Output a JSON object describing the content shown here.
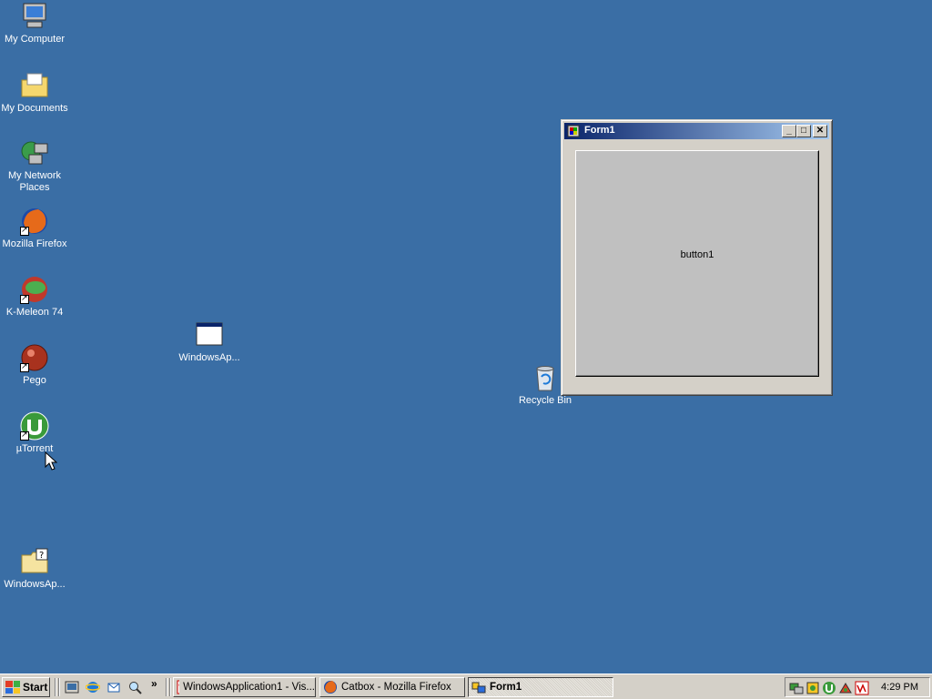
{
  "desktop_icons": [
    {
      "label": "My Computer",
      "icon": "computer-icon"
    },
    {
      "label": "My Documents",
      "icon": "documents-folder-icon"
    },
    {
      "label": "My Network Places",
      "icon": "network-places-icon"
    },
    {
      "label": "Mozilla Firefox",
      "icon": "firefox-icon"
    },
    {
      "label": "K-Meleon 74",
      "icon": "k-meleon-icon"
    },
    {
      "label": "Pego",
      "icon": "pego-icon"
    },
    {
      "label": "µTorrent",
      "icon": "utorrent-icon"
    },
    {
      "label": "WindowsAp...",
      "icon": "help-folder-icon"
    },
    {
      "label": "WindowsAp...",
      "icon": "window-app-icon"
    },
    {
      "label": "Recycle Bin",
      "icon": "recycle-bin-icon"
    }
  ],
  "window": {
    "title": "Form1",
    "minimize": "_",
    "maximize": "□",
    "close": "✕",
    "button_label": "button1"
  },
  "taskbar": {
    "start_label": "Start",
    "chevron": "»",
    "tasks": [
      {
        "label": "WindowsApplication1 - Vis...",
        "icon": "visual-studio-icon"
      },
      {
        "label": "Catbox - Mozilla Firefox",
        "icon": "firefox-icon"
      },
      {
        "label": "Form1",
        "icon": "form-icon",
        "active": true
      }
    ],
    "clock": "4:29 PM"
  },
  "colors": {
    "desktop": "#3a6ea5",
    "title_start": "#0a246a",
    "title_end": "#a6caf0",
    "chrome": "#d4d0c8"
  }
}
